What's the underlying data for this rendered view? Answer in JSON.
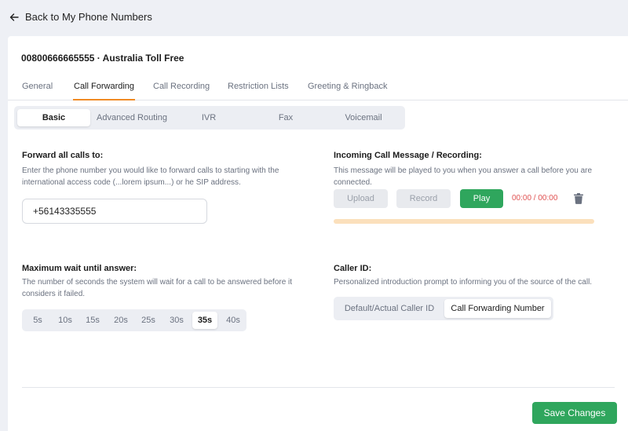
{
  "nav": {
    "back_label": "Back to My Phone Numbers"
  },
  "page": {
    "title": "00800666665555 · Australia Toll Free"
  },
  "tabs": [
    {
      "label": "General"
    },
    {
      "label": "Call Forwarding",
      "active": true
    },
    {
      "label": "Call Recording"
    },
    {
      "label": "Restriction Lists"
    },
    {
      "label": "Greeting & Ringback"
    }
  ],
  "subtabs": [
    {
      "label": "Basic",
      "active": true
    },
    {
      "label": "Advanced Routing"
    },
    {
      "label": "IVR"
    },
    {
      "label": "Fax"
    },
    {
      "label": "Voicemail"
    }
  ],
  "forward": {
    "label": "Forward all calls to:",
    "help": "Enter the phone number you would like to forward calls to starting with the international access code (...lorem ipsum...) or he SIP address.",
    "value": "+56143335555"
  },
  "incoming": {
    "label": "Incoming Call Message / Recording:",
    "help": "This message will be played to you when you answer a call before you are connected.",
    "upload_label": "Upload",
    "record_label": "Record",
    "play_label": "Play",
    "timer": "00:00 / 00:00",
    "progress": 0,
    "icon": "trash-icon"
  },
  "wait": {
    "label": "Maximum wait until answer:",
    "help": "The number of seconds the system will wait for a call to be answered before it considers it failed.",
    "options": [
      "5s",
      "10s",
      "15s",
      "20s",
      "25s",
      "30s",
      "35s",
      "40s"
    ],
    "selected": "35s"
  },
  "caller_id": {
    "label": "Caller ID:",
    "help": "Personalized introduction prompt to informing you of the source of the call.",
    "options": [
      {
        "label": "Default/Actual Caller ID"
      },
      {
        "label": "Call Forwarding Number",
        "active": true
      }
    ]
  },
  "footer": {
    "save_label": "Save Changes"
  },
  "colors": {
    "accent": "#f08a24",
    "success": "#2fa65d",
    "danger": "#e05252",
    "progress_track": "#fbe0bc"
  }
}
